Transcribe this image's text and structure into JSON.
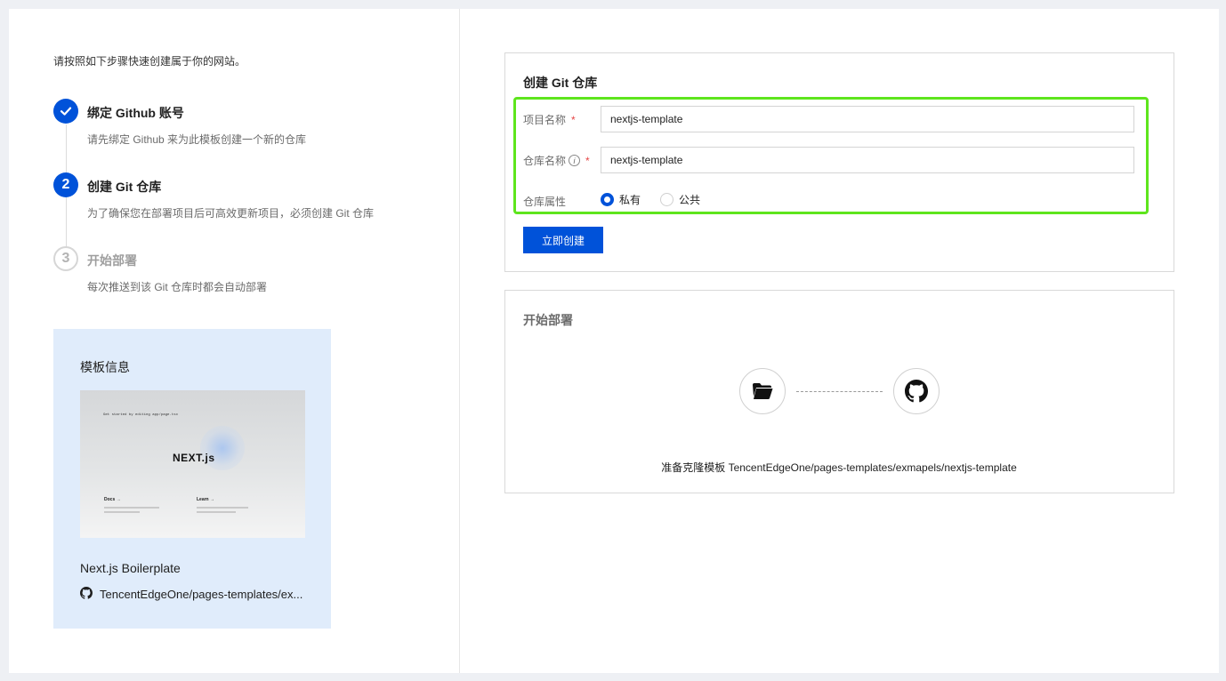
{
  "intro": "请按照如下步骤快速创建属于你的网站。",
  "steps": [
    {
      "title": "绑定 Github 账号",
      "desc": "请先绑定 Github 来为此模板创建一个新的仓库",
      "status": "done"
    },
    {
      "title": "创建 Git 仓库",
      "desc": "为了确保您在部署项目后可高效更新项目，必须创建 Git 仓库",
      "status": "active",
      "number": "2"
    },
    {
      "title": "开始部署",
      "desc": "每次推送到该 Git 仓库时都会自动部署",
      "status": "pending",
      "number": "3"
    }
  ],
  "template": {
    "section_title": "模板信息",
    "preview": {
      "top_text": "Get started by editing app/page.tsx",
      "logo": "NEXT.js",
      "docs": "Docs →",
      "learn": "Learn →"
    },
    "name": "Next.js Boilerplate",
    "repo": "TencentEdgeOne/pages-templates/ex..."
  },
  "create_repo": {
    "title": "创建 Git 仓库",
    "project_name_label": "项目名称",
    "project_name_value": "nextjs-template",
    "repo_name_label": "仓库名称",
    "repo_name_value": "nextjs-template",
    "visibility_label": "仓库属性",
    "options": [
      "私有",
      "公共"
    ],
    "selected": "私有",
    "submit_label": "立即创建"
  },
  "deploy": {
    "title": "开始部署",
    "status_text": "准备克隆模板 TencentEdgeOne/pages-templates/exmapels/nextjs-template"
  },
  "colors": {
    "primary": "#0052d9",
    "highlight": "#5ee51d",
    "template_bg": "#e0ecfb",
    "required": "#e54545"
  }
}
